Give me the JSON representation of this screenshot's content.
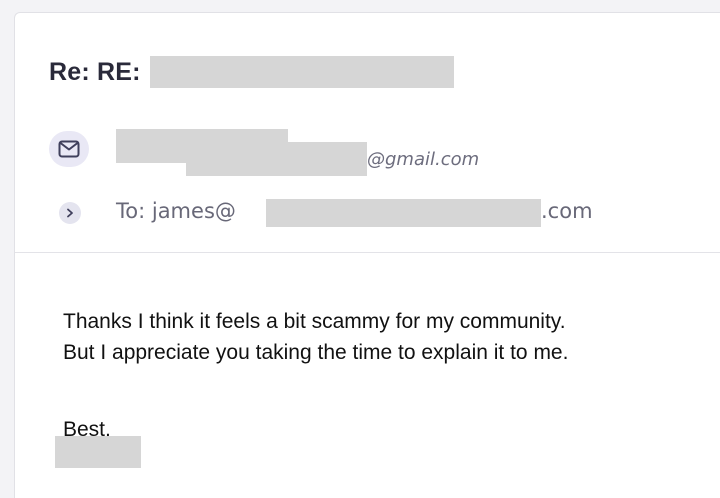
{
  "email": {
    "subject_prefix": "Re: RE:",
    "sender": {
      "email_suffix": "@gmail.com",
      "icon": "mail-icon"
    },
    "recipient": {
      "label": "To: james@",
      "domain_suffix": ".com",
      "expand_icon": "chevron-right-icon"
    },
    "body": {
      "lines": [
        "Thanks I think it feels a bit scammy for my community.",
        "But I appreciate you taking the time to explain it to me."
      ],
      "signoff": "Best,"
    }
  },
  "colors": {
    "redaction": "#d6d6d6",
    "badge_bg": "#e9e8f5",
    "icon": "#3f3f5c"
  }
}
